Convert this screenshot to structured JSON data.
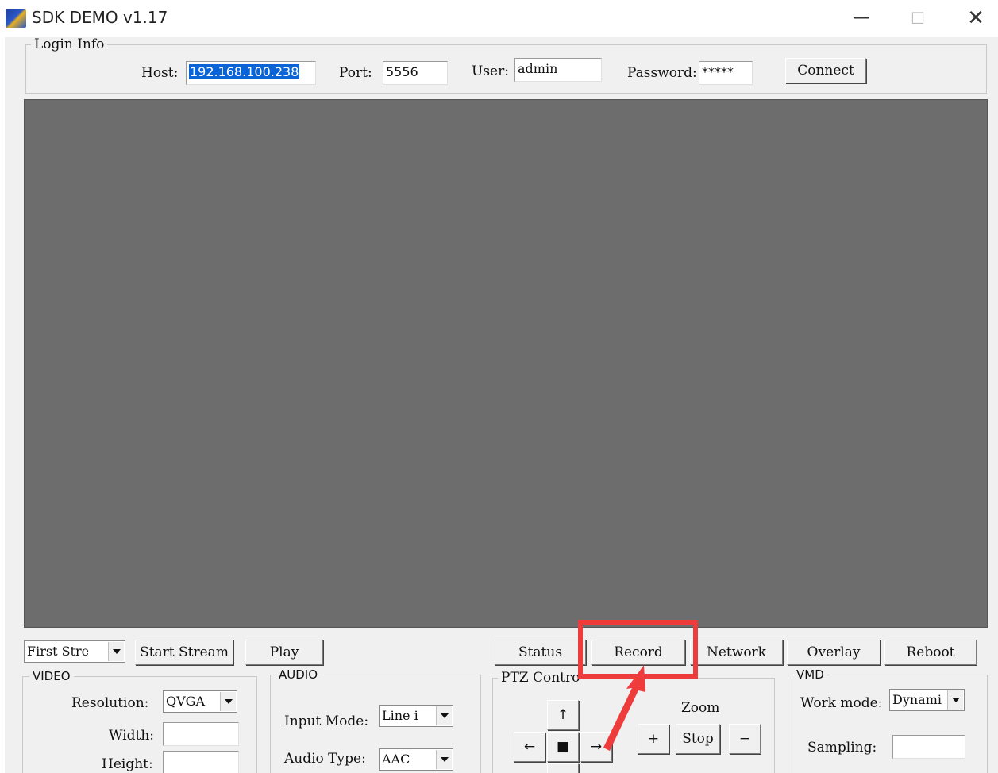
{
  "window": {
    "title": "SDK DEMO v1.17",
    "minimize_glyph": "—",
    "maximize_glyph": "☐",
    "close_glyph": "✕",
    "icon": "app-logo-icon"
  },
  "login": {
    "legend": "Login Info",
    "host_label": "Host:",
    "host_value": "192.168.100.238",
    "port_label": "Port:",
    "port_value": "5556",
    "user_label": "User:",
    "user_value": "admin",
    "password_label": "Password:",
    "password_value": "*****",
    "connect_label": "Connect"
  },
  "stream_bar": {
    "stream_select": "First Stre",
    "start_stream_label": "Start Stream",
    "play_label": "Play",
    "status_label": "Status",
    "record_label": "Record",
    "network_label": "Network",
    "overlay_label": "Overlay",
    "reboot_label": "Reboot"
  },
  "video": {
    "legend": "VIDEO",
    "resolution_label": "Resolution:",
    "resolution_value": "QVGA",
    "width_label": "Width:",
    "height_label": "Height:"
  },
  "audio": {
    "legend": "AUDIO",
    "input_mode_label": "Input Mode:",
    "input_mode_value": "Line i",
    "audio_type_label": "Audio Type:",
    "audio_type_value": "AAC"
  },
  "ptz": {
    "legend": "PTZ Contro",
    "up_glyph": "↑",
    "left_glyph": "←",
    "stop_glyph": "■",
    "right_glyph": "→",
    "zoom_label": "Zoom",
    "zoom_in_label": "+",
    "zoom_stop_label": "Stop",
    "zoom_out_label": "−"
  },
  "vmd": {
    "legend": "VMD",
    "work_mode_label": "Work mode:",
    "work_mode_value": "Dynami",
    "sampling_label": "Sampling:"
  },
  "annotation": {
    "color": "#ee3b3b"
  }
}
